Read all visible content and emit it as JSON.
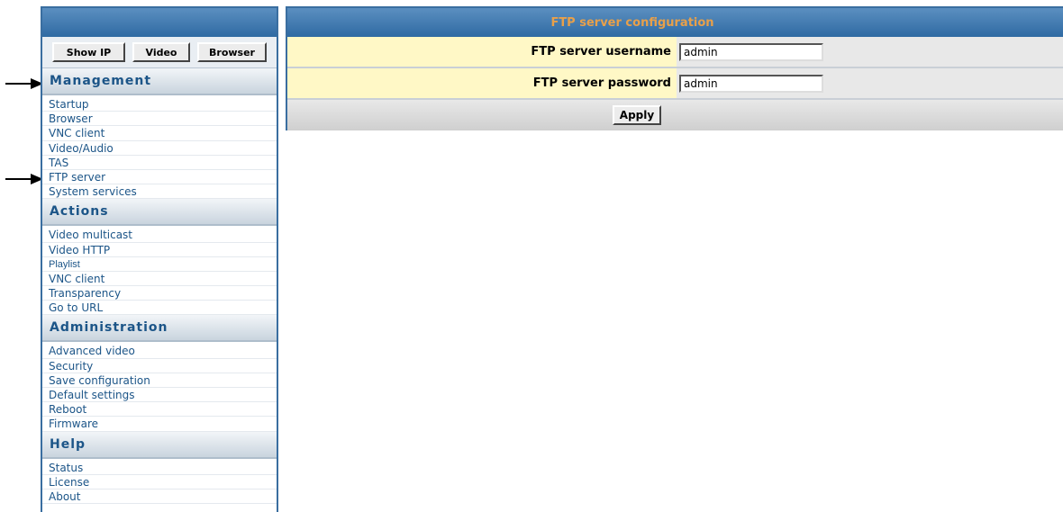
{
  "toolbar": {
    "show_ip": "Show IP",
    "video": "Video",
    "browser": "Browser"
  },
  "sections": {
    "management": {
      "title": "Management",
      "items": [
        "Startup",
        "Browser",
        "VNC client",
        "Video/Audio",
        "TAS",
        "FTP server",
        "System services"
      ]
    },
    "actions": {
      "title": "Actions",
      "items": [
        "Video multicast",
        "Video HTTP",
        "Playlist",
        "VNC client",
        "Transparency",
        "Go to URL"
      ]
    },
    "administration": {
      "title": "Administration",
      "items": [
        "Advanced video",
        "Security",
        "Save configuration",
        "Default settings",
        "Reboot",
        "Firmware"
      ]
    },
    "help": {
      "title": "Help",
      "items": [
        "Status",
        "License",
        "About"
      ]
    }
  },
  "panel": {
    "title": "FTP server configuration",
    "username_label": "FTP server username",
    "username_value": "admin",
    "password_label": "FTP server password",
    "password_value": "admin",
    "apply_label": "Apply"
  }
}
